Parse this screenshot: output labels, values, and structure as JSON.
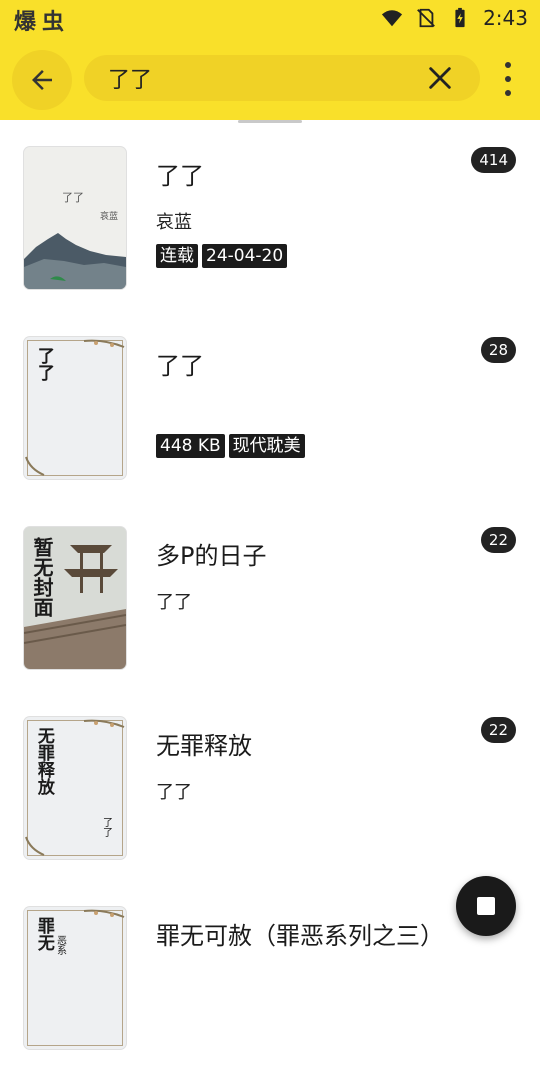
{
  "status_bar": {
    "app_glyphs": "爆虫",
    "time": "2:43"
  },
  "search": {
    "query": "了了"
  },
  "results": [
    {
      "title": "了了",
      "author": "哀蓝",
      "tags": [
        "连载",
        "24-04-20"
      ],
      "count": "414",
      "cover": {
        "style": "mountain",
        "title": "了了",
        "author": "哀蓝"
      }
    },
    {
      "title": "了了",
      "author": "",
      "tags": [
        "448 KB",
        "现代耽美"
      ],
      "count": "28",
      "cover": {
        "style": "placeholder",
        "vertical_text": "了了"
      }
    },
    {
      "title": "多P的日子",
      "author": "了了",
      "tags": [],
      "count": "22",
      "cover": {
        "style": "pavilion",
        "vertical_text": "暂无封面"
      }
    },
    {
      "title": "无罪释放",
      "author": "了了",
      "tags": [],
      "count": "22",
      "cover": {
        "style": "placeholder",
        "vertical_text": "无罪释放",
        "corner_text": "了了"
      }
    },
    {
      "title": "罪无可赦（罪恶系列之三）",
      "author": "",
      "tags": [],
      "count": "",
      "cover": {
        "style": "placeholder",
        "vertical_text": "罪无",
        "corner_text": "恶系"
      }
    }
  ],
  "colors": {
    "appbar": "#f9e02a",
    "pill": "#f0d226",
    "badge": "#222222"
  },
  "icons": {
    "back": "arrow-left-icon",
    "clear": "close-icon",
    "more": "more-vert-icon",
    "fab": "stop-icon"
  }
}
